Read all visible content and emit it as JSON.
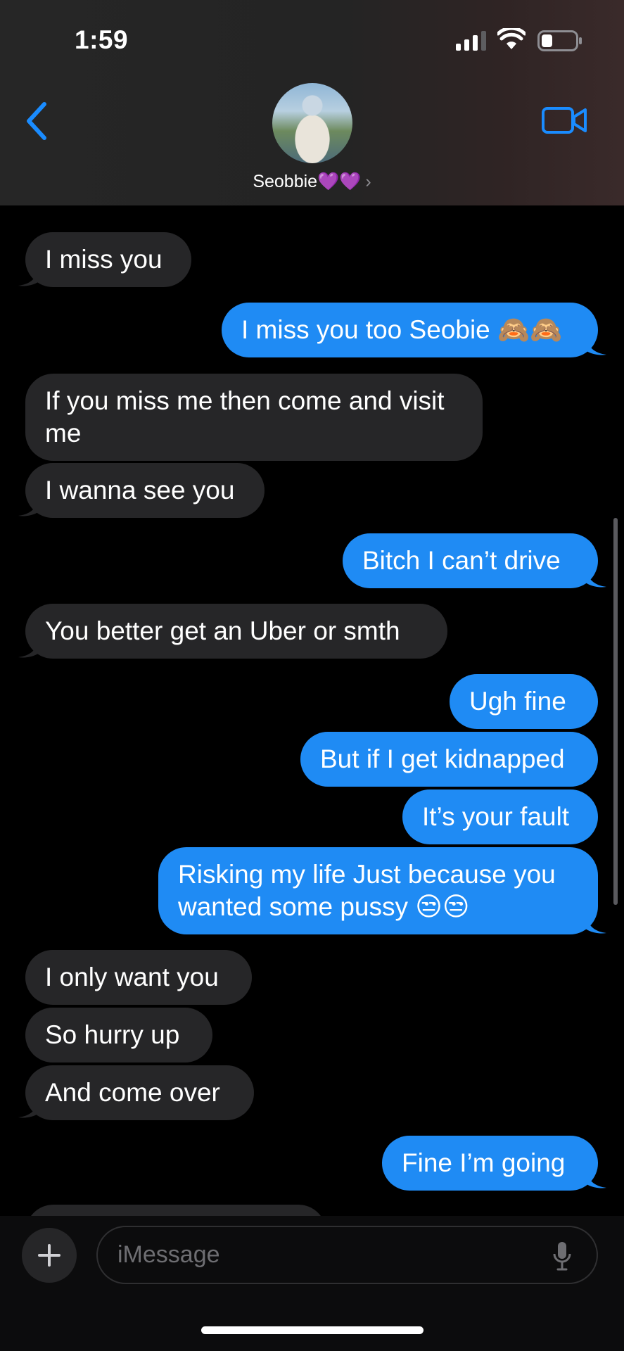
{
  "status_bar": {
    "time": "1:59"
  },
  "contact": {
    "name": "Seobbie💜💜",
    "chevron": "›"
  },
  "messages": [
    {
      "from": "them",
      "text": "I miss you"
    },
    {
      "from": "me",
      "text": "I miss you too Seobie 🙈🙈"
    },
    {
      "from": "them",
      "text": "If you miss me then come and visit me"
    },
    {
      "from": "them",
      "text": "I wanna see you"
    },
    {
      "from": "me",
      "text": "Bitch I can’t drive"
    },
    {
      "from": "them",
      "text": "You better get an Uber or smth"
    },
    {
      "from": "me",
      "text": "Ugh fine"
    },
    {
      "from": "me",
      "text": "But if I get kidnapped"
    },
    {
      "from": "me",
      "text": "It’s your fault"
    },
    {
      "from": "me",
      "text": "Risking my life Just because you wanted some pussy 😒😒"
    },
    {
      "from": "them",
      "text": "I only want you"
    },
    {
      "from": "them",
      "text": "So hurry up"
    },
    {
      "from": "them",
      "text": "And come over"
    },
    {
      "from": "me",
      "text": "Fine I’m going"
    }
  ],
  "composer": {
    "placeholder": "iMessage",
    "plus_label": "+"
  },
  "colors": {
    "sent_bubble": "#1f8bf4",
    "received_bubble": "#262628",
    "accent": "#1a8cff"
  },
  "icons": [
    "back-chevron-icon",
    "video-call-icon",
    "signal-icon",
    "wifi-icon",
    "battery-icon",
    "plus-icon",
    "microphone-icon"
  ]
}
